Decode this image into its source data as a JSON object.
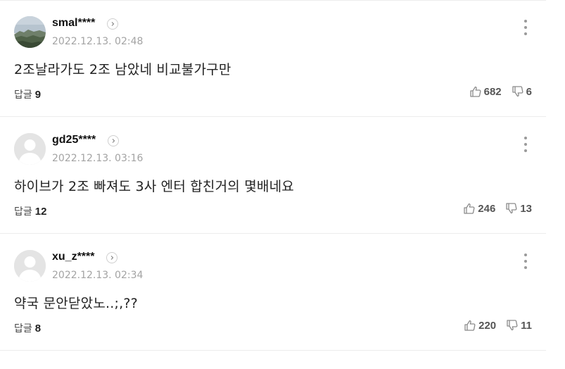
{
  "ui": {
    "reply_label": "답글"
  },
  "comments": [
    {
      "nickname": "smal****",
      "datetime": "2022.12.13. 02:48",
      "text": "2조날라가도 2조 남았네 비교불가구만",
      "replies": "9",
      "likes": "682",
      "dislikes": "6",
      "avatar": "landscape-photo"
    },
    {
      "nickname": "gd25****",
      "datetime": "2022.12.13. 03:16",
      "text": "하이브가 2조 빠져도 3사 엔터 합친거의 몇배네요",
      "replies": "12",
      "likes": "246",
      "dislikes": "13",
      "avatar": "default-profile"
    },
    {
      "nickname": "xu_z****",
      "datetime": "2022.12.13. 02:34",
      "text": "약국 문안닫았노..;,??",
      "replies": "8",
      "likes": "220",
      "dislikes": "11",
      "avatar": "default-profile"
    }
  ],
  "colors": {
    "divider": "#ececec",
    "date": "#a3a3a3",
    "icon": "#8a8a8a"
  }
}
